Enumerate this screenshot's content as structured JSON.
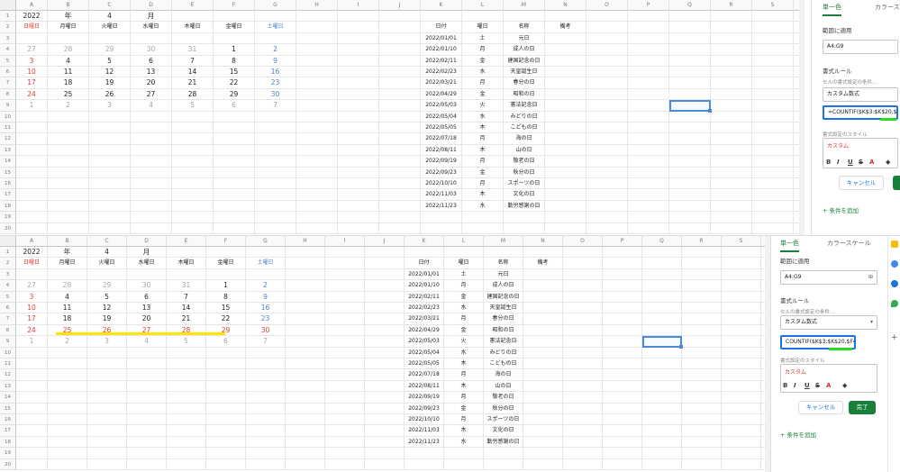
{
  "cols_top": [
    "A",
    "B",
    "C",
    "D",
    "E",
    "F",
    "G",
    "H",
    "I",
    "J",
    "K",
    "L",
    "M",
    "N",
    "O",
    "P",
    "Q",
    "R",
    "S",
    "T"
  ],
  "cols_bot": [
    "A",
    "B",
    "C",
    "D",
    "E",
    "F",
    "G",
    "H",
    "I",
    "J",
    "K",
    "L",
    "M",
    "N",
    "O",
    "P",
    "Q",
    "R",
    "S",
    "T"
  ],
  "rows": [
    "1",
    "2",
    "3",
    "4",
    "5",
    "6",
    "7",
    "8",
    "9",
    "10",
    "11",
    "12",
    "13",
    "14",
    "15",
    "16",
    "17",
    "18",
    "19",
    "20"
  ],
  "cal": {
    "year": "2022",
    "year_unit": "年",
    "month": "4",
    "month_unit": "月",
    "weekdays": [
      "日曜日",
      "月曜日",
      "火曜日",
      "水曜日",
      "木曜日",
      "金曜日",
      "土曜日"
    ],
    "weeks": [
      [
        "27",
        "28",
        "29",
        "30",
        "31",
        "1",
        "2"
      ],
      [
        "3",
        "4",
        "5",
        "6",
        "7",
        "8",
        "9"
      ],
      [
        "10",
        "11",
        "12",
        "13",
        "14",
        "15",
        "16"
      ],
      [
        "17",
        "18",
        "19",
        "20",
        "21",
        "22",
        "23"
      ],
      [
        "24",
        "25",
        "26",
        "27",
        "28",
        "29",
        "30"
      ],
      [
        "1",
        "2",
        "3",
        "4",
        "5",
        "6",
        "7"
      ]
    ],
    "week_colors_top": [
      [
        "gray",
        "gray",
        "gray",
        "gray",
        "gray",
        "dark",
        "blue"
      ],
      [
        "red",
        "dark",
        "dark",
        "dark",
        "dark",
        "dark",
        "blue"
      ],
      [
        "red",
        "dark",
        "dark",
        "dark",
        "dark",
        "dark",
        "blue"
      ],
      [
        "red",
        "dark",
        "dark",
        "dark",
        "dark",
        "dark",
        "blue"
      ],
      [
        "red",
        "dark",
        "dark",
        "dark",
        "dark",
        "dark",
        "blue"
      ],
      [
        "gray",
        "gray",
        "gray",
        "gray",
        "gray",
        "gray",
        "gray"
      ]
    ],
    "week_colors_bot": [
      [
        "gray",
        "gray",
        "gray",
        "gray",
        "gray",
        "dark",
        "blue"
      ],
      [
        "red",
        "dark",
        "dark",
        "dark",
        "dark",
        "dark",
        "blue"
      ],
      [
        "red",
        "dark",
        "dark",
        "dark",
        "dark",
        "dark",
        "blue"
      ],
      [
        "red",
        "dark",
        "dark",
        "dark",
        "dark",
        "dark",
        "blue"
      ],
      [
        "red",
        "red",
        "red",
        "red",
        "red",
        "red",
        "red"
      ],
      [
        "gray",
        "gray",
        "gray",
        "gray",
        "gray",
        "gray",
        "gray"
      ]
    ]
  },
  "holiday_headers": {
    "date": "日付",
    "weekday": "曜日",
    "name": "名称",
    "note": "備考"
  },
  "holidays": [
    [
      "2022/01/01",
      "土",
      "元日"
    ],
    [
      "2022/01/10",
      "月",
      "成人の日"
    ],
    [
      "2022/02/11",
      "金",
      "建国記念の日"
    ],
    [
      "2022/02/23",
      "水",
      "天皇誕生日"
    ],
    [
      "2022/03/21",
      "月",
      "春分の日"
    ],
    [
      "2022/04/29",
      "金",
      "昭和の日"
    ],
    [
      "2022/05/03",
      "火",
      "憲法記念日"
    ],
    [
      "2022/05/04",
      "水",
      "みどりの日"
    ],
    [
      "2022/05/05",
      "木",
      "こどもの日"
    ],
    [
      "2022/07/18",
      "月",
      "海の日"
    ],
    [
      "2022/08/11",
      "木",
      "山の日"
    ],
    [
      "2022/09/19",
      "月",
      "敬老の日"
    ],
    [
      "2022/09/23",
      "金",
      "秋分の日"
    ],
    [
      "2022/10/10",
      "月",
      "スポーツの日"
    ],
    [
      "2022/11/03",
      "木",
      "文化の日"
    ],
    [
      "2022/11/23",
      "水",
      "勤労感謝の日"
    ]
  ],
  "panel_top": {
    "tab_single": "単一色",
    "tab_scale": "カラース",
    "range_label": "範囲に適用",
    "range_value": "A4:G9",
    "rules_label": "書式ルール",
    "cond_label": "セルの書式設定の条件...",
    "cond_value": "カスタム数式",
    "formula": "=COUNTIF($K$3:$K$20,$A",
    "style_label": "書式設定のスタイル",
    "style_value": "カスタム",
    "cancel": "キャンセル",
    "add_rule": "+ 条件を追加"
  },
  "panel_bot": {
    "tab_single": "単一色",
    "tab_scale": "カラースケール",
    "range_label": "範囲に適用",
    "range_value": "A4:G9",
    "rules_label": "書式ルール",
    "cond_label": "セルの書式設定の条件...",
    "cond_value": "カスタム数式",
    "formula": "COUNTIF($K$3:$K$20,$F4)",
    "style_label": "書式設定のスタイル",
    "style_value": "カスタム",
    "cancel": "キャンセル",
    "done": "完了",
    "add_rule": "+ 条件を追加"
  },
  "format_buttons": [
    "B",
    "I",
    "U",
    "S",
    "A",
    "◆"
  ],
  "colors": {
    "accent_green": "#188038",
    "highlight_green": "#22dd22",
    "highlight_yellow": "#ffe600",
    "sunday_red": "#e53935",
    "saturday_blue": "#4a7fd6"
  },
  "icons": [
    "grid-icon",
    "dropdown-icon",
    "paint-bucket-icon",
    "keep-icon",
    "tasks-icon",
    "contacts-icon",
    "maps-icon",
    "plus-icon"
  ]
}
